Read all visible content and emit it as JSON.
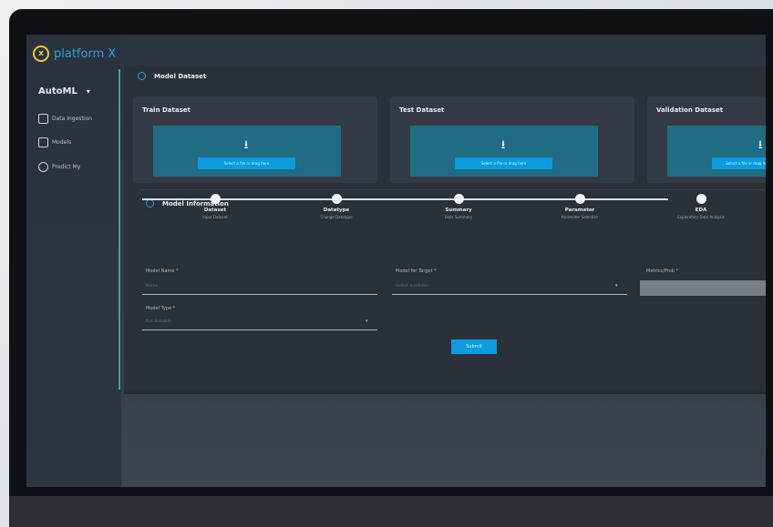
{
  "brand": {
    "logo_glyph": "x",
    "name": "platform X"
  },
  "sidebar": {
    "app_title": "AutoML",
    "caret": "▾",
    "items": [
      {
        "label": "Data Ingestion",
        "icon": "image-icon"
      },
      {
        "label": "Models",
        "icon": "monitor-icon"
      },
      {
        "label": "Predict My",
        "icon": "clock-icon"
      }
    ]
  },
  "model_dataset": {
    "title": "Model Dataset",
    "cards": [
      {
        "title": "Train Dataset",
        "button": "Select a file or drag here",
        "icon_glyph": "⭳"
      },
      {
        "title": "Test Dataset",
        "button": "Select a file or drag here",
        "icon_glyph": "⭳"
      },
      {
        "title": "Validation Dataset",
        "button": "Select a file or drag here",
        "icon_glyph": "⭳"
      }
    ]
  },
  "model_information": {
    "title": "Model Information",
    "steps": [
      {
        "label": "Dataset",
        "sub": "Input Dataset"
      },
      {
        "label": "Datatype",
        "sub": "Change Datatype"
      },
      {
        "label": "Summary",
        "sub": "Data Summary"
      },
      {
        "label": "Parameter",
        "sub": "Parameter Selection"
      },
      {
        "label": "EDA",
        "sub": "Exploratory Data Analysis"
      }
    ],
    "fields": {
      "model_name_label": "Model Name *",
      "model_name_placeholder": "Name",
      "model_for_label": "Model for Target *",
      "model_for_placeholder": "Select a column",
      "metrics_label": "Metrics/Prob *",
      "model_type_label": "Model Type *",
      "model_type_placeholder": "Not Suitable"
    },
    "submit_label": "Submit"
  },
  "colors": {
    "accent": "#0a9be0",
    "logo_yellow": "#f2c230",
    "teal": "#1f6c84"
  }
}
